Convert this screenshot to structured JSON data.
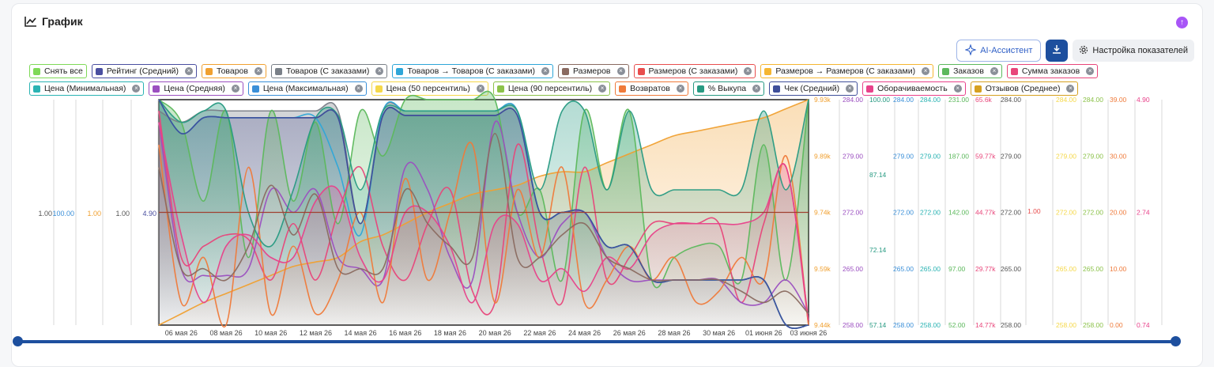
{
  "header": {
    "title": "График"
  },
  "toolbar": {
    "ai_label": "AI-Ассистент",
    "settings_label": "Настройка показателей"
  },
  "chips": [
    {
      "label": "Снять все",
      "color": "#7ed957",
      "closable": false
    },
    {
      "label": "Рейтинг (Средний)",
      "color": "#4a4fa0",
      "closable": true
    },
    {
      "label": "Товаров",
      "color": "#f0a030",
      "closable": true
    },
    {
      "label": "Товаров (С заказами)",
      "color": "#7a8088",
      "closable": true
    },
    {
      "label": "Товаров → Товаров (С заказами)",
      "color": "#2ea6d8",
      "closable": true
    },
    {
      "label": "Размеров",
      "color": "#8a6a60",
      "closable": true
    },
    {
      "label": "Размеров (С заказами)",
      "color": "#e84d4d",
      "closable": true
    },
    {
      "label": "Размеров → Размеров (С заказами)",
      "color": "#f5b631",
      "closable": true
    },
    {
      "label": "Заказов",
      "color": "#5cb85c",
      "closable": true
    },
    {
      "label": "Сумма заказов",
      "color": "#e8457a",
      "closable": true
    },
    {
      "label": "Цена (Минимальная)",
      "color": "#2ab3b3",
      "closable": true
    },
    {
      "label": "Цена (Средняя)",
      "color": "#9b4fc0",
      "closable": true
    },
    {
      "label": "Цена (Максимальная)",
      "color": "#3a8fd8",
      "closable": true
    },
    {
      "label": "Цена (50 персентиль)",
      "color": "#f5d84a",
      "closable": true
    },
    {
      "label": "Цена (90 персентиль)",
      "color": "#8cc24a",
      "closable": true
    },
    {
      "label": "Возвратов",
      "color": "#ef7a3a",
      "closable": true
    },
    {
      "label": "% Выкупа",
      "color": "#279a82",
      "closable": true
    },
    {
      "label": "Чек (Средний)",
      "color": "#3f4f9a",
      "closable": true
    },
    {
      "label": "Оборачиваемость",
      "color": "#e8418a",
      "closable": true
    },
    {
      "label": "Отзывов (Среднее)",
      "color": "#d6a020",
      "closable": true
    }
  ],
  "chart_data": {
    "type": "area",
    "x": [
      "05 мая 26",
      "06 мая 26",
      "07 мая 26",
      "08 мая 26",
      "09 мая 26",
      "10 мая 26",
      "11 мая 26",
      "12 мая 26",
      "13 мая 26",
      "14 мая 26",
      "15 мая 26",
      "16 мая 26",
      "17 мая 26",
      "18 мая 26",
      "19 мая 26",
      "20 мая 26",
      "21 мая 26",
      "22 мая 26",
      "23 мая 26",
      "24 мая 26",
      "25 мая 26",
      "26 мая 26",
      "27 мая 26",
      "28 мая 26",
      "29 мая 26",
      "30 мая 26",
      "31 мая 26",
      "01 июня 26",
      "02 июня 26",
      "03 июня 26"
    ],
    "xticks": [
      "06 мая 26",
      "08 мая 26",
      "10 мая 26",
      "12 мая 26",
      "14 мая 26",
      "16 мая 26",
      "18 мая 26",
      "20 мая 26",
      "22 мая 26",
      "24 мая 26",
      "26 мая 26",
      "28 мая 26",
      "30 мая 26",
      "01 июня 26",
      "03 июня 26"
    ],
    "left_axes": [
      {
        "label": "1.00",
        "color": "#555555"
      },
      {
        "label": "100.00",
        "color": "#3a8fd8"
      },
      {
        "label": "1.00",
        "color": "#f0a030"
      },
      {
        "label": "1.00",
        "color": "#555555"
      },
      {
        "label": "4.90",
        "color": "#4a4fa0"
      }
    ],
    "right_axes": [
      {
        "color": "#f0a030",
        "ticks": [
          "9.93k",
          "9.89k",
          "9.74k",
          "9.59k",
          "9.44k"
        ]
      },
      {
        "color": "#9b4fc0",
        "ticks": [
          "284.00",
          "279.00",
          "272.00",
          "265.00",
          "258.00"
        ]
      },
      {
        "color": "#279a82",
        "ticks": [
          "100.00",
          "87.14",
          "72.14",
          "57.14"
        ]
      },
      {
        "color": "#3a8fd8",
        "ticks": [
          "284.00",
          "279.00",
          "272.00",
          "265.00",
          "258.00"
        ]
      },
      {
        "color": "#2ab3b3",
        "ticks": [
          "284.00",
          "279.00",
          "272.00",
          "265.00",
          "258.00"
        ]
      },
      {
        "color": "#5cb85c",
        "ticks": [
          "231.00",
          "187.00",
          "142.00",
          "97.00",
          "52.00"
        ]
      },
      {
        "color": "#e8457a",
        "ticks": [
          "65.6k",
          "59.77k",
          "44.77k",
          "29.77k",
          "14.77k"
        ]
      },
      {
        "color": "#555555",
        "ticks": [
          "284.00",
          "279.00",
          "272.00",
          "265.00",
          "258.00"
        ]
      },
      {
        "color": "#e84d4d",
        "ticks": [
          "1.00"
        ]
      },
      {
        "color": "#f5d84a",
        "ticks": [
          "284.00",
          "279.00",
          "272.00",
          "265.00",
          "258.00"
        ]
      },
      {
        "color": "#8cc24a",
        "ticks": [
          "284.00",
          "279.00",
          "272.00",
          "265.00",
          "258.00"
        ]
      },
      {
        "color": "#ef7a3a",
        "ticks": [
          "39.00",
          "30.00",
          "20.00",
          "10.00",
          "0.00"
        ]
      },
      {
        "color": "#e8418a",
        "ticks": [
          "4.90",
          "2.74",
          "0.74"
        ]
      }
    ],
    "series": [
      {
        "name": "Рейтинг (Средний)",
        "color": "#4a4fa0",
        "fill": true,
        "values": [
          1,
          0.85,
          0.92,
          0.92,
          0.92,
          0.92,
          0.92,
          0.92,
          0.92,
          0.45,
          0.93,
          0.93,
          0.93,
          0.93,
          0.93,
          0.93,
          0.93,
          0.5,
          0.5,
          0.5,
          0.35,
          0.35,
          0.2,
          0.2,
          0.2,
          0.2,
          0.2,
          0.2,
          0.0,
          0.0
        ]
      },
      {
        "name": "Товаров",
        "color": "#f0a030",
        "fill": true,
        "values": [
          0.0,
          0.05,
          0.1,
          0.14,
          0.18,
          0.22,
          0.26,
          0.28,
          0.3,
          0.37,
          0.4,
          0.45,
          0.5,
          0.54,
          0.58,
          0.6,
          0.62,
          0.66,
          0.68,
          0.68,
          0.72,
          0.76,
          0.8,
          0.84,
          0.86,
          0.88,
          0.9,
          0.92,
          0.96,
          1.0
        ]
      },
      {
        "name": "Товаров (С заказами)",
        "color": "#7a8088",
        "fill": true,
        "values": [
          0.95,
          0.9,
          0.95,
          0.95,
          0.95,
          0.95,
          0.95,
          0.95,
          0.95,
          0.45,
          0.95,
          0.95,
          0.95,
          0.95,
          0.95,
          0.95,
          0.95,
          0.5,
          0.5,
          0.5,
          0.35,
          0.35,
          0.2,
          0.2,
          0.2,
          0.2,
          0.2,
          0.2,
          0.0,
          0.0
        ]
      },
      {
        "name": "Товаров → Товаров (С заказами)",
        "color": "#2ea6d8",
        "fill": false,
        "values": [
          1,
          0.85,
          0.92,
          0.92,
          0.92,
          0.92,
          0.92,
          0.92,
          0.7,
          0.4,
          0.95,
          0.95,
          0.95,
          0.95,
          0.95,
          0.95,
          0.95,
          0.5,
          0.5,
          0.5,
          0.35,
          0.35,
          0.2,
          0.2,
          0.2,
          0.2,
          0.2,
          0.2,
          0.0,
          0.0
        ]
      },
      {
        "name": "Заказов",
        "color": "#5cb85c",
        "fill": true,
        "values": [
          1,
          0.9,
          0.55,
          0.95,
          0.3,
          0.95,
          0.55,
          0.9,
          0.45,
          0.95,
          0.75,
          1.0,
          1.0,
          1.0,
          1.0,
          1.0,
          0.5,
          0.6,
          0.2,
          0.95,
          0.6,
          0.95,
          0.2,
          0.3,
          0.35,
          0.35,
          0.2,
          0.8,
          0.2,
          1.0
        ]
      },
      {
        "name": "Сумма заказов",
        "color": "#e8457a",
        "fill": false,
        "values": [
          0.95,
          0.3,
          0.35,
          0.4,
          0.38,
          0.2,
          0.45,
          0.2,
          0.5,
          0.7,
          0.35,
          0.2,
          0.45,
          0.6,
          0.15,
          0.1,
          0.8,
          0.35,
          0.1,
          0.7,
          0.2,
          0.3,
          0.45,
          0.45,
          0.45,
          0.45,
          0.1,
          0.45,
          0.7,
          0.0
        ]
      },
      {
        "name": "Цена (Средняя)",
        "color": "#9b4fc0",
        "fill": false,
        "values": [
          0.9,
          0.25,
          0.22,
          0.22,
          0.25,
          0.6,
          0.5,
          0.6,
          0.3,
          0.25,
          0.2,
          0.7,
          0.6,
          0.3,
          0.2,
          0.9,
          0.5,
          0.3,
          0.45,
          0.5,
          0.3,
          0.2,
          0.2,
          0.2,
          0.2,
          0.2,
          0.1,
          0.1,
          0.2,
          0.05
        ]
      },
      {
        "name": "Возвратов",
        "color": "#ef7a3a",
        "fill": false,
        "values": [
          0.8,
          0.1,
          0.3,
          0.0,
          0.7,
          0.05,
          0.35,
          0.05,
          0.2,
          0.5,
          0.1,
          0.65,
          0.2,
          0.5,
          0.8,
          0.1,
          0.6,
          0.3,
          0.7,
          0.1,
          0.2,
          0.35,
          0.2,
          0.3,
          0.1,
          0.15,
          0.3,
          0.2,
          0.75,
          0.0
        ]
      },
      {
        "name": "% Выкупа",
        "color": "#279a82",
        "fill": true,
        "values": [
          1.0,
          0.9,
          0.95,
          0.95,
          0.5,
          0.35,
          0.6,
          0.92,
          0.93,
          0.6,
          0.95,
          0.95,
          0.95,
          0.95,
          0.95,
          0.95,
          0.95,
          0.6,
          0.95,
          0.95,
          0.6,
          0.95,
          0.6,
          0.6,
          0.6,
          0.6,
          0.6,
          0.95,
          0.6,
          1.0
        ]
      },
      {
        "name": "Чек (Средний)",
        "color": "#3f4f9a",
        "fill": false,
        "values": [
          1,
          0.85,
          0.92,
          0.92,
          0.92,
          0.92,
          0.92,
          0.92,
          0.92,
          0.45,
          0.93,
          0.93,
          0.93,
          0.93,
          0.93,
          0.93,
          0.93,
          0.5,
          0.5,
          0.5,
          0.35,
          0.35,
          0.2,
          0.2,
          0.2,
          0.2,
          0.2,
          0.2,
          0.0,
          0.0
        ]
      },
      {
        "name": "Оборачиваемость",
        "color": "#e8418a",
        "fill": true,
        "values": [
          0.9,
          0.4,
          0.1,
          0.35,
          0.4,
          0.3,
          0.3,
          0.55,
          0.6,
          0.3,
          0.2,
          0.5,
          0.5,
          0.35,
          0.1,
          0.45,
          0.45,
          0.2,
          0.25,
          0.15,
          0.3,
          0.25,
          0.4,
          0.45,
          0.45,
          0.45,
          0.45,
          0.5,
          0.7,
          0.02
        ]
      },
      {
        "name": "Размеров",
        "color": "#8a6a60",
        "fill": false,
        "values": [
          0.7,
          0.25,
          0.25,
          0.2,
          0.35,
          0.62,
          0.4,
          0.58,
          0.25,
          0.25,
          0.25,
          0.6,
          0.45,
          0.35,
          0.3,
          0.85,
          0.3,
          0.3,
          0.4,
          0.45,
          0.3,
          0.25,
          0.2,
          0.2,
          0.2,
          0.2,
          0.15,
          0.1,
          0.15,
          0.05
        ]
      }
    ],
    "reference_line": {
      "value": 0.5,
      "color": "#a04030"
    }
  }
}
